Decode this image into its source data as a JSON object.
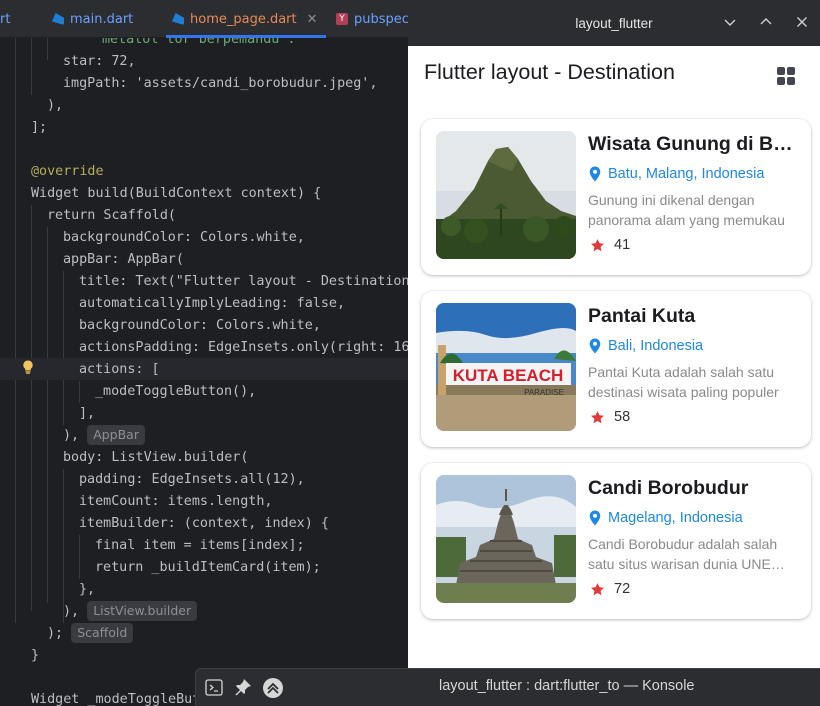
{
  "ide": {
    "tabs": [
      {
        "label": "rt"
      },
      {
        "label": "main.dart"
      },
      {
        "label": "home_page.dart",
        "active": true
      },
      {
        "label": "pubspec"
      }
    ],
    "code_lines": [
      {
        "text": "metatol tor berpemandu ."
      },
      {
        "text": "star: 72,"
      },
      {
        "text": "imgPath: 'assets/candi_borobudur.jpeg',"
      },
      {
        "text": "),"
      },
      {
        "text": "];"
      },
      {
        "text": "@override"
      },
      {
        "text": "Widget build(BuildContext context) {"
      },
      {
        "text": "return Scaffold("
      },
      {
        "text": "backgroundColor: Colors.white,"
      },
      {
        "text": "appBar: AppBar("
      },
      {
        "text": "title: Text(\"Flutter layout - Destination"
      },
      {
        "text": "automaticallyImplyLeading: false,"
      },
      {
        "text": "backgroundColor: Colors.white,"
      },
      {
        "text": "actionsPadding: EdgeInsets.only(right: 16"
      },
      {
        "text": "actions: ["
      },
      {
        "text": "_modeToggleButton(),"
      },
      {
        "text": "],"
      },
      {
        "text": "),"
      },
      {
        "text": "body: ListView.builder("
      },
      {
        "text": "padding: EdgeInsets.all(12),"
      },
      {
        "text": "itemCount: items.length,"
      },
      {
        "text": "itemBuilder: (context, index) {"
      },
      {
        "text": "final item = items[index];"
      },
      {
        "text": "return _buildItemCard(item);"
      },
      {
        "text": "},"
      },
      {
        "text": "),"
      },
      {
        "text": ");"
      },
      {
        "text": "}"
      },
      {
        "text": "Widget _modeToggleBut"
      }
    ],
    "inlay_hints": {
      "appbar": "AppBar",
      "listview": "ListView.builder",
      "scaffold": "Scaffold"
    }
  },
  "app_window": {
    "title": "layout_flutter",
    "appbar_title": "Flutter layout - Destination",
    "mode_icon": "grid-view-icon",
    "destinations": [
      {
        "name": "Wisata Gunung di Batu",
        "location": "Batu, Malang, Indonesia",
        "description_lines": [
          "Gunung ini dikenal dengan",
          "panorama alam yang memukau"
        ],
        "rating": "41",
        "image": "mountain"
      },
      {
        "name": "Pantai Kuta",
        "location": "Bali, Indonesia",
        "description_lines": [
          "Pantai Kuta adalah salah satu",
          "destinasi wisata paling populer"
        ],
        "rating": "58",
        "image": "beach",
        "image_text": "KUTA BEACH",
        "image_subtext": "PARADISE"
      },
      {
        "name": "Candi Borobudur",
        "location": "Magelang, Indonesia",
        "description_lines": [
          "Candi Borobudur adalah salah",
          "satu situs warisan dunia UNESCO"
        ],
        "rating": "72",
        "image": "temple"
      }
    ],
    "colors": {
      "location": "#1e88e5",
      "star": "#e53935"
    }
  },
  "konsole": {
    "title": "layout_flutter : dart:flutter_to — Konsole"
  }
}
